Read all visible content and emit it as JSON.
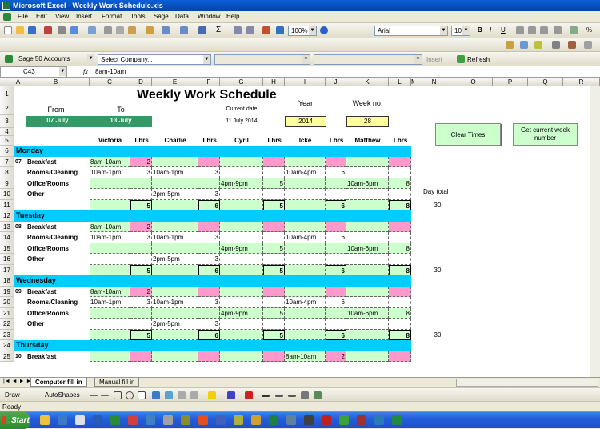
{
  "window": {
    "title": "Microsoft Excel - Weekly Work Schedule.xls"
  },
  "menu": [
    "File",
    "Edit",
    "View",
    "Insert",
    "Format",
    "Tools",
    "Sage",
    "Data",
    "Window",
    "Help"
  ],
  "toolbar": {
    "zoom": "100%",
    "font": "Arial",
    "font_size": "10"
  },
  "sage_bar": {
    "accounts": "Sage 50 Accounts",
    "company": "Select Company...",
    "insert": "Insert",
    "refresh": "Refresh"
  },
  "formula_bar": {
    "name_box": "C43",
    "fx": "fx",
    "value": "8am-10am"
  },
  "columns": [
    "A",
    "B",
    "C",
    "D",
    "E",
    "F",
    "G",
    "H",
    "I",
    "J",
    "K",
    "L",
    "M",
    "N",
    "O",
    "P",
    "Q",
    "R"
  ],
  "sheet": {
    "title": "Weekly Work Schedule",
    "from_label": "From",
    "to_label": "To",
    "from_value": "07  July",
    "to_value": "13  July",
    "current_date_label": "Current date",
    "current_date": "11 July 2014",
    "year_label": "Year",
    "year": "2014",
    "week_label": "Week no.",
    "week": "28",
    "clear_button": "Clear Times",
    "week_button": "Get current week number",
    "day_total_label": "Day total",
    "headers": [
      "Victoria",
      "T.hrs",
      "Charlie",
      "T.hrs",
      "Cyril",
      "T.hrs",
      "Icke",
      "T.hrs",
      "Matthew",
      "T.hrs"
    ],
    "days": [
      {
        "name": "Monday",
        "num": "07",
        "rows": [
          {
            "task": "Breakfast",
            "v": "8am-10am",
            "vh": "2",
            "c": "",
            "ch": "",
            "cy": "",
            "cyh": "",
            "i": "",
            "ih": "",
            "m": "",
            "mh": ""
          },
          {
            "task": "Rooms/Cleaning",
            "v": "10am-1pm",
            "vh": "3",
            "c": "10am-1pm",
            "ch": "3",
            "cy": "",
            "cyh": "",
            "i": "10am-4pm",
            "ih": "6",
            "m": "",
            "mh": ""
          },
          {
            "task": "Office/Rooms",
            "v": "",
            "vh": "",
            "c": "",
            "ch": "",
            "cy": "4pm-9pm",
            "cyh": "5",
            "i": "",
            "ih": "",
            "m": "10am-6pm",
            "mh": "8"
          },
          {
            "task": "Other",
            "v": "",
            "vh": "",
            "c": "2pm-5pm",
            "ch": "3",
            "cy": "",
            "cyh": "",
            "i": "",
            "ih": "",
            "m": "",
            "mh": ""
          }
        ],
        "totals": [
          "5",
          "6",
          "5",
          "6",
          "8"
        ],
        "day_total": "30"
      },
      {
        "name": "Tuesday",
        "num": "08",
        "rows": [
          {
            "task": "Breakfast",
            "v": "8am-10am",
            "vh": "2",
            "c": "",
            "ch": "",
            "cy": "",
            "cyh": "",
            "i": "",
            "ih": "",
            "m": "",
            "mh": ""
          },
          {
            "task": "Rooms/Cleaning",
            "v": "10am-1pm",
            "vh": "3",
            "c": "10am-1pm",
            "ch": "3",
            "cy": "",
            "cyh": "",
            "i": "10am-4pm",
            "ih": "6",
            "m": "",
            "mh": ""
          },
          {
            "task": "Office/Rooms",
            "v": "",
            "vh": "",
            "c": "",
            "ch": "",
            "cy": "4pm-9pm",
            "cyh": "5",
            "i": "",
            "ih": "",
            "m": "10am-6pm",
            "mh": "8"
          },
          {
            "task": "Other",
            "v": "",
            "vh": "",
            "c": "2pm-5pm",
            "ch": "3",
            "cy": "",
            "cyh": "",
            "i": "",
            "ih": "",
            "m": "",
            "mh": ""
          }
        ],
        "totals": [
          "5",
          "6",
          "5",
          "6",
          "8"
        ],
        "day_total": "30"
      },
      {
        "name": "Wednesday",
        "num": "09",
        "rows": [
          {
            "task": "Breakfast",
            "v": "8am-10am",
            "vh": "2",
            "c": "",
            "ch": "",
            "cy": "",
            "cyh": "",
            "i": "",
            "ih": "",
            "m": "",
            "mh": ""
          },
          {
            "task": "Rooms/Cleaning",
            "v": "10am-1pm",
            "vh": "3",
            "c": "10am-1pm",
            "ch": "3",
            "cy": "",
            "cyh": "",
            "i": "10am-4pm",
            "ih": "6",
            "m": "",
            "mh": ""
          },
          {
            "task": "Office/Rooms",
            "v": "",
            "vh": "",
            "c": "",
            "ch": "",
            "cy": "4pm-9pm",
            "cyh": "5",
            "i": "",
            "ih": "",
            "m": "10am-6pm",
            "mh": "8"
          },
          {
            "task": "Other",
            "v": "",
            "vh": "",
            "c": "2pm-5pm",
            "ch": "3",
            "cy": "",
            "cyh": "",
            "i": "",
            "ih": "",
            "m": "",
            "mh": ""
          }
        ],
        "totals": [
          "5",
          "6",
          "5",
          "6",
          "8"
        ],
        "day_total": "30"
      },
      {
        "name": "Thursday",
        "num": "10",
        "rows": [
          {
            "task": "Breakfast",
            "v": "",
            "vh": "",
            "c": "",
            "ch": "",
            "cy": "",
            "cyh": "",
            "i": "8am-10am",
            "ih": "2",
            "m": "",
            "mh": ""
          }
        ],
        "totals": [],
        "day_total": ""
      }
    ]
  },
  "sheet_tabs": [
    "Computer fill in",
    "Manual fill in"
  ],
  "draw_bar": {
    "draw": "Draw",
    "autoshapes": "AutoShapes"
  },
  "status": "Ready",
  "taskbar": {
    "start": "Start"
  }
}
